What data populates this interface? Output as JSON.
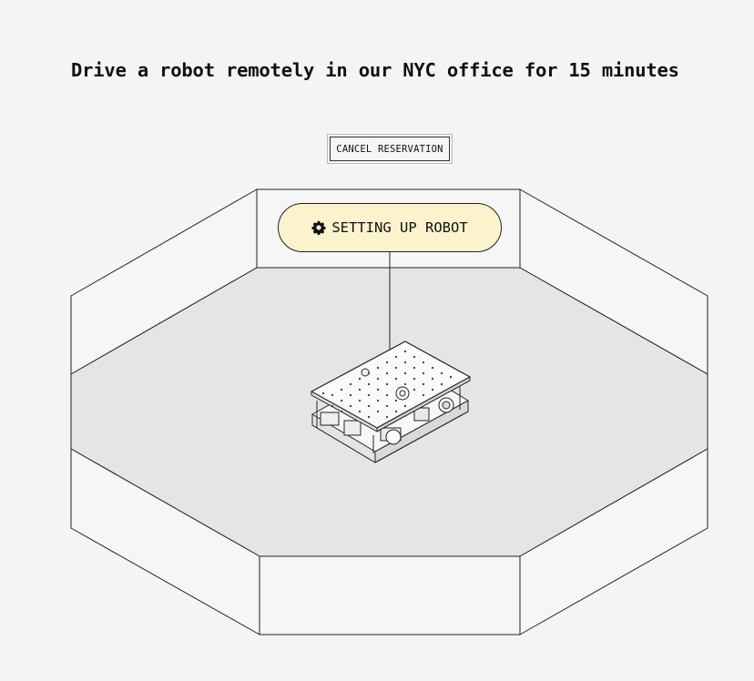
{
  "page": {
    "title": "Drive a robot remotely in our NYC office for 15 minutes"
  },
  "actions": {
    "cancel_label": "CANCEL RESERVATION"
  },
  "status": {
    "label": "SETTING UP ROBOT",
    "icon": "gear-icon",
    "background": "#fbf3cd"
  },
  "colors": {
    "page_background": "#f4f4f4",
    "floor": "#e6e5e4",
    "outline": "#222222"
  }
}
